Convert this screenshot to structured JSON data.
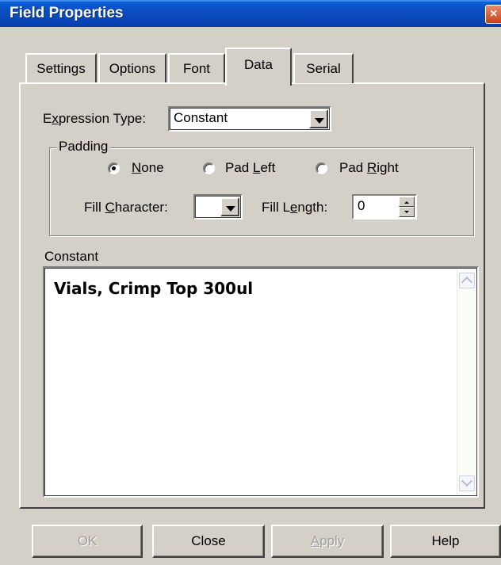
{
  "window": {
    "title": "Field Properties",
    "close_glyph": "×"
  },
  "tabs": [
    {
      "label": "Settings"
    },
    {
      "label": "Options"
    },
    {
      "label": "Font"
    },
    {
      "label": "Data",
      "active": true
    },
    {
      "label": "Serial"
    }
  ],
  "expression": {
    "label_prefix": "E",
    "label_accel": "x",
    "label_rest": "pression Type:",
    "value": "Constant"
  },
  "padding": {
    "legend": "Padding",
    "options": [
      {
        "accel": "N",
        "rest": "one",
        "checked": true
      },
      {
        "pre": "Pad ",
        "accel": "L",
        "rest": "eft",
        "checked": false
      },
      {
        "pre": "Pad ",
        "accel": "R",
        "rest": "ight",
        "checked": false
      }
    ],
    "fill_char": {
      "pre": "Fill ",
      "accel": "C",
      "rest": "haracter:",
      "value": ""
    },
    "fill_length": {
      "pre": "Fill L",
      "accel": "e",
      "rest": "ngth:",
      "value": "0"
    }
  },
  "constant": {
    "label": "Constant",
    "text": "Vials, Crimp Top 300ul"
  },
  "buttons": {
    "ok": {
      "label": "OK",
      "disabled": true
    },
    "close": {
      "label": "Close"
    },
    "apply": {
      "accel": "A",
      "rest": "pply",
      "disabled": true
    },
    "help": {
      "label": "Help"
    }
  }
}
